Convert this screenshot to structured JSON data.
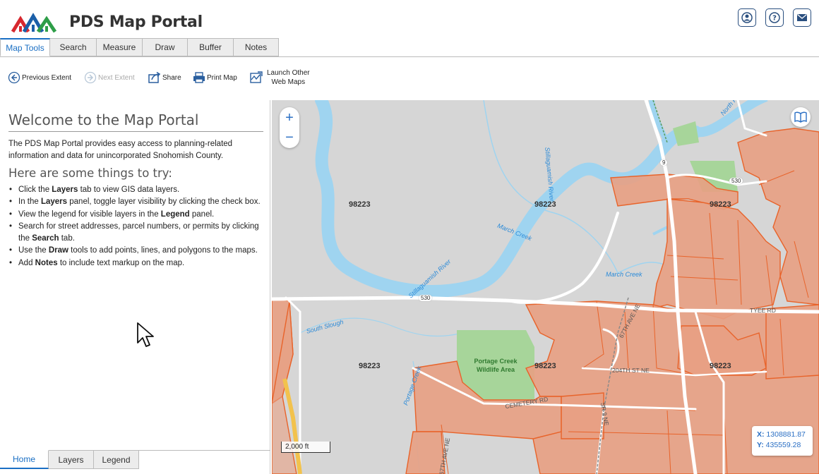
{
  "app": {
    "title": "PDS Map Portal"
  },
  "header_buttons": [
    {
      "name": "user-icon"
    },
    {
      "name": "help-icon"
    },
    {
      "name": "mail-icon"
    }
  ],
  "tabs": [
    {
      "label": "Map Tools",
      "active": true
    },
    {
      "label": "Search"
    },
    {
      "label": "Measure"
    },
    {
      "label": "Draw"
    },
    {
      "label": "Buffer"
    },
    {
      "label": "Notes"
    }
  ],
  "toolbar": {
    "previous_extent": "Previous Extent",
    "next_extent": "Next Extent",
    "share": "Share",
    "print_map": "Print Map",
    "launch_line1": "Launch Other",
    "launch_line2": "Web Maps"
  },
  "panel": {
    "welcome_title": "Welcome to the Map Portal",
    "intro": "The PDS Map Portal provides easy access to planning-related information and data for unincorporated Snohomish County.",
    "try_title": "Here are some things to try:",
    "tips": [
      {
        "pre": "Click the ",
        "bold": "Layers",
        "post": " tab to view GIS data layers."
      },
      {
        "pre": "In the ",
        "bold": "Layers",
        "post": " panel, toggle layer visibility by clicking the check box."
      },
      {
        "pre": "View the legend for visible layers in the ",
        "bold": "Legend",
        "post": " panel."
      },
      {
        "pre": "Search for street addresses, parcel numbers, or permits by clicking the ",
        "bold": "Search",
        "post": " tab."
      },
      {
        "pre": "Use the ",
        "bold": "Draw",
        "post": " tools to add points, lines, and polygons to the maps."
      },
      {
        "pre": "Add ",
        "bold": "Notes",
        "post": " to include text markup on the map."
      }
    ]
  },
  "bottom_tabs": [
    {
      "label": "Home",
      "active": true
    },
    {
      "label": "Layers"
    },
    {
      "label": "Legend"
    }
  ],
  "map": {
    "zoom_in": "+",
    "zoom_out": "−",
    "scale": "2,000 ft",
    "coord_x_label": "X:",
    "coord_x": "1308881.87",
    "coord_y_label": "Y:",
    "coord_y": "435559.28",
    "zip_labels": [
      "98223",
      "98223",
      "98223",
      "98223",
      "98223",
      "98223"
    ],
    "water_labels": [
      "Stillaguamish River",
      "March Creek",
      "March Creek",
      "Stillaguamish River",
      "South Slough",
      "Portage Creek",
      "North F"
    ],
    "road_labels": [
      "TYEE RD",
      "67TH AVE NE",
      "204TH ST NE",
      "CEMETERY RD",
      "SR 9 NE",
      "67TH AVE NE"
    ],
    "shields": [
      "9",
      "530",
      "530"
    ],
    "park_line1": "Portage Creek",
    "park_line2": "Wildlife Area"
  },
  "colors": {
    "accent": "#1a6fc4",
    "parcel_fill": "#e8a083",
    "parcel_stroke": "#e8632a",
    "water": "#9fd4f0",
    "park": "#a7d59a",
    "map_bg": "#d6d6d6"
  }
}
